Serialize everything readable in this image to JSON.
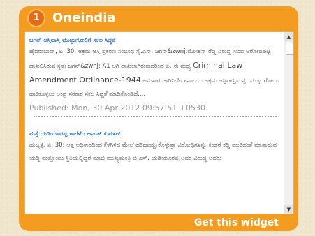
{
  "header": {
    "badge": "1",
    "title": "Oneindia"
  },
  "items": [
    {
      "title": "ಜಗನ್ ಆಸ್ತಿಪಾಸ್ತಿ ಮುಟ್ಟುಗೋಲಿಗೆ ಸಕಲ ಸಿದ್ಧತೆ",
      "text_part1": "ಹೈದರಾಬಾದ್, ಏ. 30: ಅಕ್ರಮ ಆಸ್ತಿ ಪ್ರಕರಣ ಸಂಬಂಧ ಸೈ.ಎಸ್. ಜಗನ್&zwnj;ಮೋಹನ್ ರೆಡ್ಡಿ ವಿರುದ್ಧ ಸಿಬಿಐ ಆರೋಪಪಟ್ಟಿ ದಾಖಲಿಸಿರುವ ಸ್ವತಃ ಜಗನ್&zwnj; A1 ಆಗಿ ದಾಖಲಾಗಿರುವುದರಿಂದ ಏ. ಈ ಮಧ್ಯೆ",
      "text_big": "Criminal Law Amendment Ordinance-1944",
      "text_part2": "ಅನುಸಾರ ಜಾರಿನಿರ್ದೇಶನಾಲಯ ಅಕ್ರಮ ಆಸ್ತಿಪಾಸ್ತಿಯನ್ನು ಮುಟ್ಟುಗೋಲು ಹಾಕಿಕೊಳ್ಳಲು ಅಂದ್ರ ಸರಕಾರ ಸಕಲ ಸಿದ್ಧತೆ ಮಾಡಿಕೊಂಡಿದೆ....",
      "published": "Published: Mon, 30 Apr 2012 09:57:51 +0530"
    },
    {
      "title": "ಮತ್ತೆ ಯಡಿಯೂರಪ್ಪ ಕಾಲೆಳೆದ ಅನಂತ್ ಕುಮಾರ್",
      "text_part1": "ಹುಬ್ಬಳ್ಳಿ, ಏ. 30: ಅತ್ತ ಅಧಿಕಾರದಿಂದ ಕೆಳಗಿಳಿದ ಮೇಲೆ ಹರಿಹಾಯ್ದುಕೊಳ್ಳುತ್ತಾ ವಿರೋಧಿಗಳನ್ನು ಕಂಡರೆ ಕಡ್ಡಿ ಮುರಿದಂತೆ ಮಾತಾಡುವ ಯಡ್ಡಿ ಮತ್ತೊಂದು ಸ್ಥಿತಿಯಲ್ಲಿದ್ದರೆ ಮಾಜಿ ಮುಖ್ಯಮಂತ್ರಿ ಬಿ.ಎಸ್. ಯಡಿಯೂರಪ್ಪ ಅವರ ವಿರುದ್ಧ ಅವರು"
    }
  ],
  "scrollbar": {
    "up": "▲",
    "down": "▼"
  },
  "footer": {
    "label": "Get this widget"
  }
}
